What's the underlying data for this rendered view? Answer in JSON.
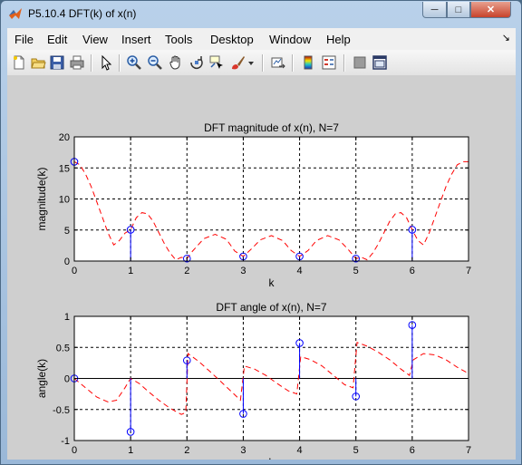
{
  "window": {
    "title": "P5.10.4 DFT(k) of x(n)"
  },
  "menu": {
    "items": [
      "File",
      "Edit",
      "View",
      "Insert",
      "Tools",
      "Desktop",
      "Window",
      "Help"
    ],
    "arrow": "↘"
  },
  "toolbar": {
    "icons": [
      "new-figure-icon",
      "open-folder-icon",
      "save-icon",
      "print-icon",
      "pointer-icon",
      "zoom-in-icon",
      "zoom-out-icon",
      "pan-hand-icon",
      "rotate-3d-icon",
      "data-cursor-icon",
      "brush-icon",
      "brush-dropdown-icon",
      "link-plot-icon",
      "colorbar-icon",
      "legend-icon",
      "hide-plot-tools-icon",
      "show-plot-tools-icon"
    ]
  },
  "chart_data": [
    {
      "type": "stem+line",
      "title": "DFT magnitude of x(n), N=7",
      "xlabel": "k",
      "ylabel": "magnitude(k)",
      "xlim": [
        0,
        7
      ],
      "ylim": [
        0,
        20
      ],
      "xticks": [
        "0",
        "1",
        "2",
        "3",
        "4",
        "5",
        "6",
        "7"
      ],
      "yticks": [
        "0",
        "5",
        "10",
        "15",
        "20"
      ],
      "grid": true,
      "stem": {
        "k": [
          0,
          1,
          2,
          3,
          4,
          5,
          6
        ],
        "values": [
          16,
          5.05,
          0.4,
          0.75,
          0.75,
          0.4,
          5.05
        ],
        "color": "#0000ff"
      },
      "line": {
        "style": "dashed",
        "color": "#ff0000",
        "x": [
          0,
          0.1,
          0.2,
          0.3,
          0.4,
          0.5,
          0.6,
          0.7,
          0.8,
          0.9,
          1.0,
          1.1,
          1.2,
          1.3,
          1.4,
          1.5,
          1.6,
          1.7,
          1.8,
          1.9,
          2.0,
          2.1,
          2.3,
          2.5,
          2.7,
          2.85,
          3.0,
          3.15,
          3.3,
          3.5,
          3.7,
          3.85,
          4.0,
          4.15,
          4.3,
          4.5,
          4.7,
          4.85,
          5.0,
          5.1,
          5.2,
          5.3,
          5.4,
          5.5,
          5.6,
          5.7,
          5.8,
          5.9,
          6.0,
          6.1,
          6.2,
          6.3,
          6.4,
          6.5,
          6.6,
          6.7,
          6.8,
          6.9,
          7.0
        ],
        "y": [
          16,
          15.5,
          14,
          12,
          9.5,
          7,
          4.5,
          2.6,
          3.3,
          4.5,
          5.05,
          7.0,
          7.8,
          7.6,
          6.4,
          4.6,
          2.8,
          1.3,
          0.2,
          0.6,
          0.4,
          1.6,
          3.6,
          4.3,
          3.5,
          1.6,
          0.75,
          2.0,
          3.4,
          4.1,
          3.3,
          1.7,
          0.75,
          1.7,
          3.3,
          4.1,
          3.4,
          2.0,
          0.4,
          0.6,
          0.2,
          1.3,
          2.8,
          4.6,
          6.4,
          7.6,
          7.8,
          7.0,
          5.05,
          3.3,
          2.6,
          4.5,
          7.0,
          9.5,
          12,
          14,
          15.5,
          16,
          16
        ]
      }
    },
    {
      "type": "stem+line",
      "title": "DFT angle of x(n), N=7",
      "xlabel": "k",
      "ylabel": "angle(k)",
      "xlim": [
        0,
        7
      ],
      "ylim": [
        -1,
        1
      ],
      "xticks": [
        "0",
        "1",
        "2",
        "3",
        "4",
        "5",
        "6",
        "7"
      ],
      "yticks": [
        "-1",
        "-0.5",
        "0",
        "0.5",
        "1"
      ],
      "grid": true,
      "stem": {
        "k": [
          0,
          1,
          2,
          3,
          4,
          5,
          6
        ],
        "values": [
          0,
          -0.86,
          0.29,
          -0.57,
          0.57,
          -0.29,
          0.86
        ],
        "color": "#0000ff"
      },
      "line": {
        "style": "dashed",
        "color": "#ff0000",
        "x": [
          0,
          0.2,
          0.4,
          0.6,
          0.75,
          0.9,
          1.0,
          1.15,
          1.3,
          1.5,
          1.7,
          1.9,
          1.98,
          2.02,
          2.2,
          2.4,
          2.6,
          2.8,
          2.95,
          3.02,
          3.2,
          3.4,
          3.6,
          3.8,
          3.95,
          4.02,
          4.2,
          4.4,
          4.6,
          4.8,
          4.95,
          5.02,
          5.2,
          5.4,
          5.6,
          5.8,
          5.95,
          6.02,
          6.2,
          6.4,
          6.6,
          6.8,
          7.0
        ],
        "y": [
          0,
          -0.15,
          -0.3,
          -0.38,
          -0.35,
          -0.15,
          0,
          -0.08,
          -0.2,
          -0.35,
          -0.48,
          -0.58,
          -0.55,
          0.4,
          0.28,
          0.12,
          -0.05,
          -0.22,
          -0.35,
          0.2,
          0.15,
          0.05,
          -0.08,
          -0.2,
          -0.25,
          0.35,
          0.3,
          0.2,
          0.05,
          -0.1,
          -0.15,
          0.58,
          0.52,
          0.42,
          0.3,
          0.15,
          0.05,
          0.3,
          0.4,
          0.38,
          0.3,
          0.18,
          0.08
        ]
      }
    }
  ]
}
